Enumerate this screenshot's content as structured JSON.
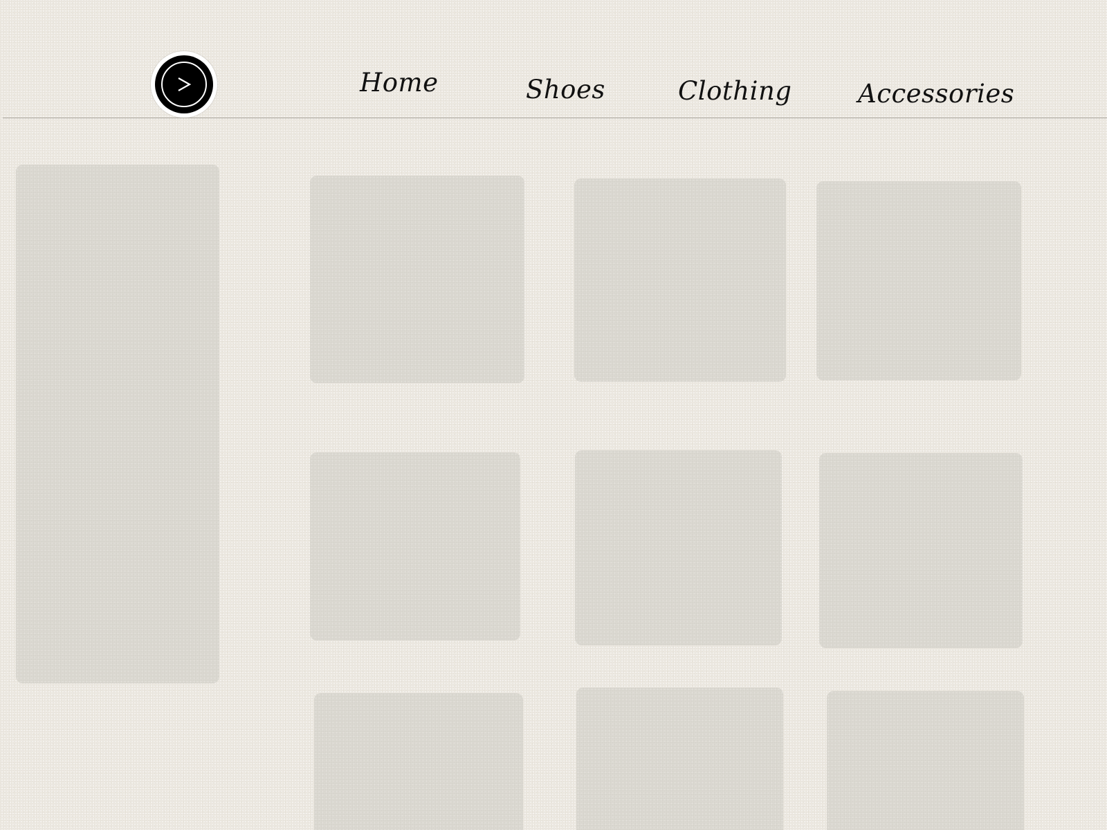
{
  "header": {
    "logo": {
      "icon": "chevron-right-icon",
      "glyph": ">"
    },
    "nav": [
      {
        "label": "Home"
      },
      {
        "label": "Shoes"
      },
      {
        "label": "Clothing"
      },
      {
        "label": "Accessories"
      }
    ]
  },
  "colors": {
    "background": "#eeeae2",
    "tile": "#dcd9d2",
    "text": "#111111",
    "logo": "#000000"
  }
}
